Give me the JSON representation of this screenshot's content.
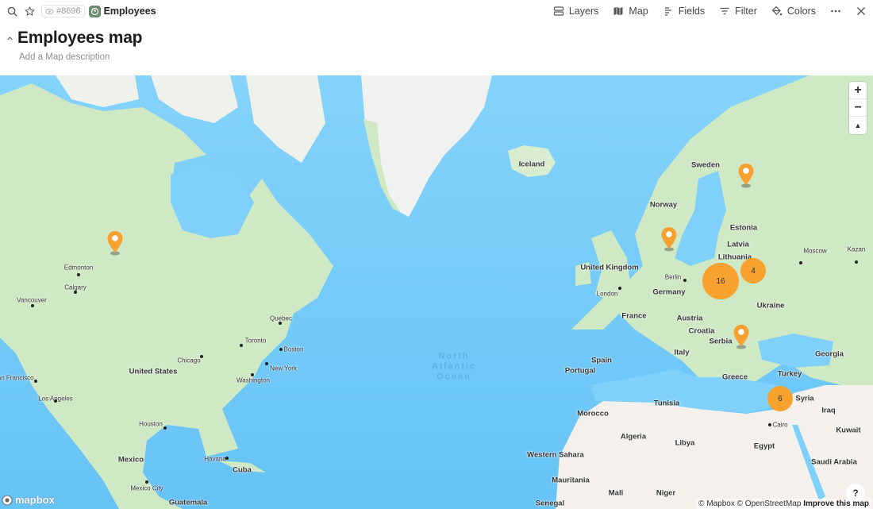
{
  "topbar": {
    "view_id": "#8696",
    "database_name": "Employees",
    "actions": [
      {
        "id": "layers",
        "label": "Layers",
        "icon": "layers-icon"
      },
      {
        "id": "map",
        "label": "Map",
        "icon": "map-icon"
      },
      {
        "id": "fields",
        "label": "Fields",
        "icon": "fields-icon"
      },
      {
        "id": "filter",
        "label": "Filter",
        "icon": "filter-icon"
      },
      {
        "id": "colors",
        "label": "Colors",
        "icon": "paint-bucket-icon"
      }
    ]
  },
  "page": {
    "title": "Employees map",
    "description_placeholder": "Add a Map description"
  },
  "map": {
    "colors": {
      "water": "#7dcffb",
      "land": "#cfe9c4",
      "ice": "#f2f3f2",
      "desert": "#f4f1ec",
      "marker": "#f7a12f"
    },
    "ocean_labels": [
      {
        "id": "north-atlantic",
        "text": "North Atlantic Ocean"
      }
    ],
    "country_labels": [
      {
        "id": "iceland",
        "text": "Iceland"
      },
      {
        "id": "sweden",
        "text": "Sweden"
      },
      {
        "id": "norway",
        "text": "Norway"
      },
      {
        "id": "estonia",
        "text": "Estonia"
      },
      {
        "id": "latvia",
        "text": "Latvia"
      },
      {
        "id": "lithuania",
        "text": "Lithuania"
      },
      {
        "id": "uk",
        "text": "United Kingdom"
      },
      {
        "id": "germany",
        "text": "Germany"
      },
      {
        "id": "france",
        "text": "France"
      },
      {
        "id": "austria",
        "text": "Austria"
      },
      {
        "id": "croatia",
        "text": "Croatia"
      },
      {
        "id": "serbia",
        "text": "Serbia"
      },
      {
        "id": "ukraine",
        "text": "Ukraine"
      },
      {
        "id": "italy",
        "text": "Italy"
      },
      {
        "id": "spain",
        "text": "Spain"
      },
      {
        "id": "portugal",
        "text": "Portugal"
      },
      {
        "id": "greece",
        "text": "Greece"
      },
      {
        "id": "turkey",
        "text": "Turkey"
      },
      {
        "id": "georgia",
        "text": "Georgia"
      },
      {
        "id": "syria",
        "text": "Syria"
      },
      {
        "id": "iraq",
        "text": "Iraq"
      },
      {
        "id": "kuwait",
        "text": "Kuwait"
      },
      {
        "id": "saudi",
        "text": "Saudi Arabia"
      },
      {
        "id": "egypt",
        "text": "Egypt"
      },
      {
        "id": "libya",
        "text": "Libya"
      },
      {
        "id": "tunisia",
        "text": "Tunisia"
      },
      {
        "id": "algeria",
        "text": "Algeria"
      },
      {
        "id": "morocco",
        "text": "Morocco"
      },
      {
        "id": "western-sahara",
        "text": "Western Sahara"
      },
      {
        "id": "mauritania",
        "text": "Mauritania"
      },
      {
        "id": "mali",
        "text": "Mali"
      },
      {
        "id": "niger",
        "text": "Niger"
      },
      {
        "id": "senegal",
        "text": "Senegal"
      },
      {
        "id": "united-states",
        "text": "United States"
      },
      {
        "id": "mexico",
        "text": "Mexico"
      },
      {
        "id": "cuba",
        "text": "Cuba"
      },
      {
        "id": "guatemala",
        "text": "Guatemala"
      }
    ],
    "city_labels": [
      {
        "id": "edmonton",
        "text": "Edmonton"
      },
      {
        "id": "calgary",
        "text": "Calgary"
      },
      {
        "id": "vancouver",
        "text": "Vancouver"
      },
      {
        "id": "san-francisco",
        "text": "San Francisco"
      },
      {
        "id": "los-angeles",
        "text": "Los Angeles"
      },
      {
        "id": "chicago",
        "text": "Chicago"
      },
      {
        "id": "toronto",
        "text": "Toronto"
      },
      {
        "id": "quebec",
        "text": "Quebec"
      },
      {
        "id": "boston",
        "text": "Boston"
      },
      {
        "id": "new-york",
        "text": "New York"
      },
      {
        "id": "washington",
        "text": "Washington"
      },
      {
        "id": "houston",
        "text": "Houston"
      },
      {
        "id": "havana",
        "text": "Havana"
      },
      {
        "id": "mexico-city",
        "text": "Mexico City"
      },
      {
        "id": "london",
        "text": "London"
      },
      {
        "id": "berlin",
        "text": "Berlin"
      },
      {
        "id": "moscow",
        "text": "Moscow"
      },
      {
        "id": "kazan",
        "text": "Kazan"
      },
      {
        "id": "cairo",
        "text": "Cairo"
      }
    ],
    "pins": [
      {
        "id": "canada-saskatchewan",
        "label": "Employee location"
      },
      {
        "id": "finland",
        "label": "Employee location"
      },
      {
        "id": "denmark",
        "label": "Employee location"
      },
      {
        "id": "romania",
        "label": "Employee location"
      }
    ],
    "clusters": [
      {
        "id": "poland",
        "count": "16"
      },
      {
        "id": "belarus",
        "count": "4"
      },
      {
        "id": "cyprus",
        "count": "6"
      }
    ],
    "controls": {
      "zoom_in": "+",
      "zoom_out": "−",
      "compass": "▲"
    },
    "logo_text": "mapbox",
    "help_label": "?",
    "attribution": {
      "mapbox": "© Mapbox",
      "osm": "© OpenStreetMap",
      "improve": "Improve this map"
    }
  }
}
